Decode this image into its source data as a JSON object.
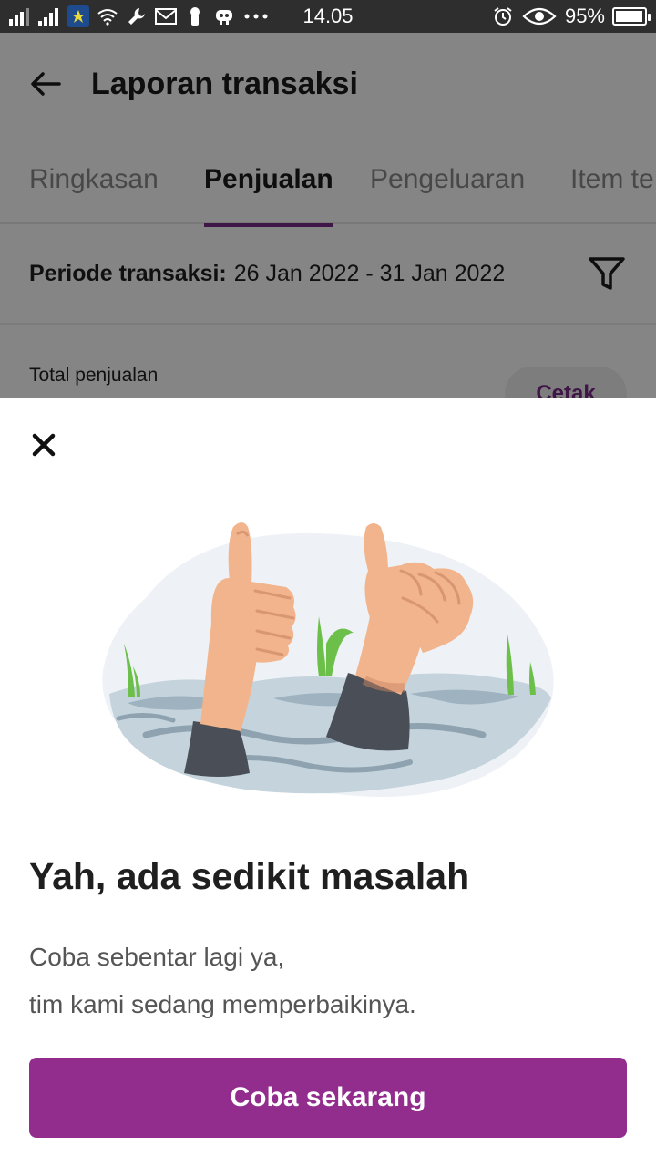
{
  "status_bar": {
    "time": "14.05",
    "battery": "95%",
    "battery_level": 0.95,
    "left_icons": [
      "signal-1-icon",
      "signal-2-icon",
      "app-notification-icon",
      "wifi-icon",
      "wrench-icon",
      "mail-icon",
      "keyhole-icon",
      "robot-icon",
      "more-dots-icon"
    ],
    "right_icons": [
      "alarm-icon",
      "eye-icon"
    ]
  },
  "app_bar": {
    "title": "Laporan transaksi",
    "back_icon": "arrow-left-icon"
  },
  "tabs": [
    {
      "label": "Ringkasan",
      "active": false
    },
    {
      "label": "Penjualan",
      "active": true
    },
    {
      "label": "Pengeluaran",
      "active": false
    },
    {
      "label": "Item te",
      "active": false
    }
  ],
  "period": {
    "label": "Periode transaksi:",
    "value": "26 Jan 2022 - 31 Jan 2022",
    "filter_icon": "filter-icon"
  },
  "summary": {
    "total_label": "Total penjualan",
    "print_button": "Cetak"
  },
  "sheet": {
    "close_icon": "close-icon",
    "illustration": "drowning-hands-thumbs-up-illustration",
    "heading": "Yah, ada sedikit masalah",
    "message_line1": "Coba sebentar lagi ya,",
    "message_line2": "tim kami sedang memperbaikinya.",
    "cta_label": "Coba sekarang"
  },
  "colors": {
    "accent": "#922d8e",
    "tab_indicator": "#7b2a88",
    "status_bar": "#2e2e2e"
  }
}
